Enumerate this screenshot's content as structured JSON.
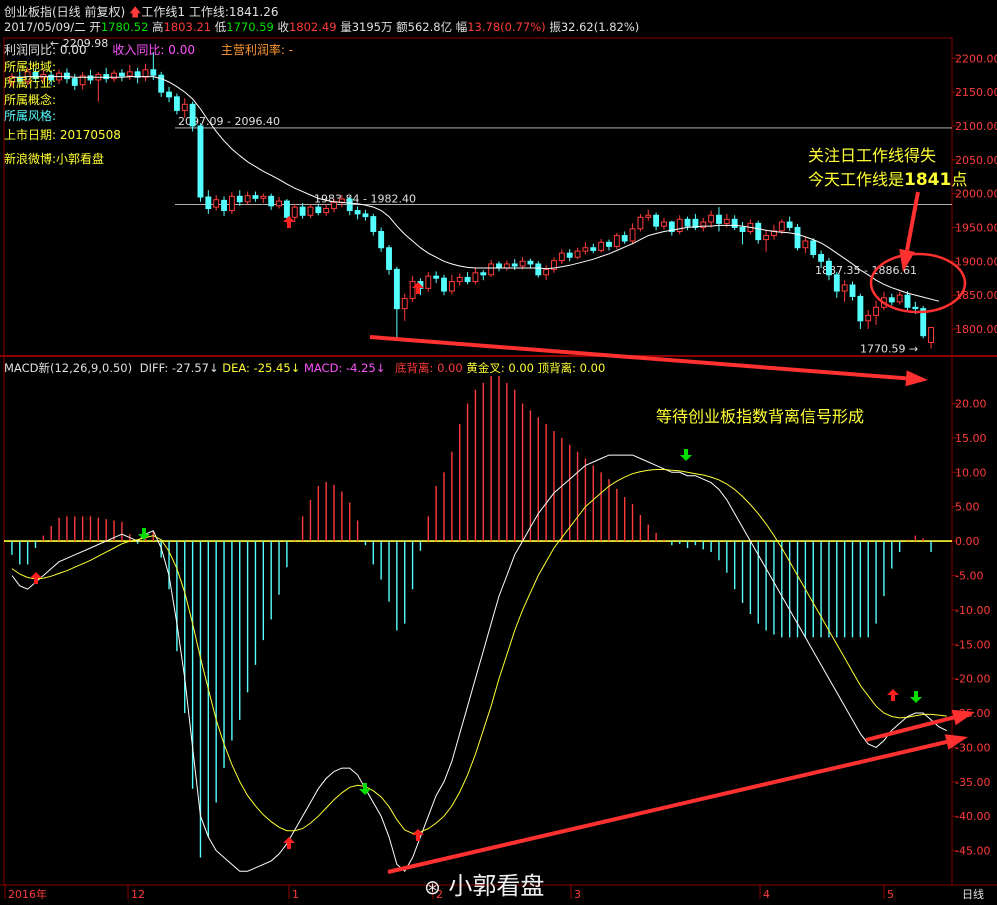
{
  "header": {
    "title": "创业板指(日线 前复权)",
    "workline1_label": "工作线1",
    "workline_label": "工作线:",
    "workline_value": "1841.26",
    "date": "2017/05/09/二",
    "open_label": "开",
    "open": "1780.52",
    "high_label": "高",
    "high": "1803.21",
    "low_label": "低",
    "low": "1770.59",
    "close_label": "收",
    "close": "1802.49",
    "volume_label": "量",
    "volume": "3195万",
    "amount_label": "额",
    "amount": "562.8亿",
    "change_label": "幅",
    "change": "13.78(0.77%)",
    "amplitude_label": "振",
    "amplitude": "32.62(1.82%)"
  },
  "info_panel": {
    "profit_yoy": "利润同比: 0.00",
    "revenue_yoy": "收入同比: 0.00",
    "margin": "主营利润率: -",
    "region": "所属地域:",
    "industry": "所属行业:",
    "concept": "所属概念:",
    "style": "所属风格:",
    "listing": "上市日期: 20170508",
    "weibo": "新浪微博:小郭看盘"
  },
  "annotations": {
    "note1_line1": "关注日工作线得失",
    "note1_line2_prefix": "今天工作线是",
    "note1_line2_value": "1841",
    "note1_line2_suffix": "点",
    "note2": "等待创业板指数背离信号形成",
    "price_label_top": "2209.98",
    "price_label_low": "1770.59",
    "level1": "2097.09 - 2096.40",
    "level2": "1983.84 - 1982.40",
    "level3": "1887.35 - 1886.61"
  },
  "macd_header": {
    "name": "MACD新(12,26,9,0.50)",
    "diff_label": "DIFF:",
    "diff": "-27.57",
    "dea_label": "DEA:",
    "dea": "-25.45",
    "macd_label": "MACD:",
    "macd": "-4.25",
    "bottom_div": "底背离: 0.00",
    "golden": "黄金叉: 0.00",
    "top_div": "顶背离: 0.00"
  },
  "x_axis": {
    "labels": [
      "2016年",
      "12",
      "1",
      "2",
      "3",
      "4",
      "5"
    ],
    "period": "日线"
  },
  "watermark": "小郭看盘",
  "colors": {
    "up": "#ff3b3b",
    "down": "#55ffff",
    "ma": "#ffffff",
    "dea": "#ffff33",
    "grid": "#8b0000",
    "annot": "#ff3030"
  },
  "chart_data": [
    {
      "type": "candlestick",
      "name": "price",
      "ylim": [
        1760,
        2230
      ],
      "y_ticks": [
        1800,
        1850,
        1900,
        1950,
        2000,
        2050,
        2100,
        2150,
        2200
      ],
      "y_tick_labels": [
        "1800.00",
        "1850.00",
        "1900.00",
        "1950.00",
        "2000.00",
        "2050.00",
        "2100.00",
        "2150.00",
        "2200.00"
      ],
      "horizontal_levels": [
        2097.09,
        1983.84
      ],
      "candles": [
        [
          2165,
          2173,
          2178,
          2158
        ],
        [
          2172,
          2166,
          2180,
          2160
        ],
        [
          2166,
          2180,
          2186,
          2161
        ],
        [
          2179,
          2170,
          2185,
          2164
        ],
        [
          2171,
          2176,
          2183,
          2165
        ],
        [
          2175,
          2168,
          2181,
          2160
        ],
        [
          2168,
          2178,
          2183,
          2162
        ],
        [
          2178,
          2170,
          2185,
          2163
        ],
        [
          2170,
          2160,
          2177,
          2153
        ],
        [
          2161,
          2174,
          2180,
          2154
        ],
        [
          2174,
          2168,
          2183,
          2162
        ],
        [
          2168,
          2176,
          2180,
          2136
        ],
        [
          2176,
          2170,
          2186,
          2164
        ],
        [
          2170,
          2178,
          2183,
          2165
        ],
        [
          2178,
          2174,
          2184,
          2166
        ],
        [
          2174,
          2180,
          2190,
          2168
        ],
        [
          2180,
          2172,
          2186,
          2163
        ],
        [
          2172,
          2183,
          2192,
          2166
        ],
        [
          2183,
          2175,
          2209,
          2168
        ],
        [
          2175,
          2150,
          2180,
          2143
        ],
        [
          2150,
          2143,
          2158,
          2135
        ],
        [
          2143,
          2123,
          2148,
          2117
        ],
        [
          2123,
          2132,
          2141,
          2112
        ],
        [
          2132,
          2100,
          2136,
          2092
        ],
        [
          2100,
          1995,
          2104,
          1988
        ],
        [
          1995,
          1978,
          2005,
          1970
        ],
        [
          1980,
          1991,
          1998,
          1975
        ],
        [
          1990,
          1975,
          1996,
          1967
        ],
        [
          1975,
          1996,
          2002,
          1970
        ],
        [
          1996,
          1988,
          2005,
          1982
        ],
        [
          1988,
          1997,
          2003,
          1984
        ],
        [
          1997,
          1993,
          2003,
          1988
        ],
        [
          1993,
          1996,
          2000,
          1986
        ],
        [
          1996,
          1982,
          2000,
          1976
        ],
        [
          1982,
          1989,
          1995,
          1978
        ],
        [
          1989,
          1965,
          1992,
          1960
        ],
        [
          1965,
          1980,
          1985,
          1958
        ],
        [
          1980,
          1968,
          1986,
          1963
        ],
        [
          1968,
          1980,
          1984,
          1964
        ],
        [
          1980,
          1972,
          1985,
          1968
        ],
        [
          1972,
          1978,
          1984,
          1967
        ],
        [
          1978,
          1987,
          1992,
          1972
        ],
        [
          1987,
          1992,
          1998,
          1980
        ],
        [
          1992,
          1975,
          1996,
          1968
        ],
        [
          1975,
          1970,
          1981,
          1962
        ],
        [
          1970,
          1966,
          1976,
          1960
        ],
        [
          1966,
          1944,
          1970,
          1938
        ],
        [
          1944,
          1920,
          1950,
          1914
        ],
        [
          1920,
          1888,
          1924,
          1880
        ],
        [
          1888,
          1830,
          1892,
          1786
        ],
        [
          1830,
          1845,
          1852,
          1812
        ],
        [
          1845,
          1870,
          1878,
          1840
        ],
        [
          1870,
          1860,
          1875,
          1850
        ],
        [
          1860,
          1878,
          1884,
          1855
        ],
        [
          1878,
          1875,
          1885,
          1868
        ],
        [
          1875,
          1856,
          1880,
          1850
        ],
        [
          1856,
          1870,
          1880,
          1851
        ],
        [
          1870,
          1876,
          1882,
          1864
        ],
        [
          1876,
          1870,
          1884,
          1866
        ],
        [
          1870,
          1883,
          1890,
          1866
        ],
        [
          1883,
          1880,
          1887,
          1872
        ],
        [
          1880,
          1896,
          1902,
          1877
        ],
        [
          1896,
          1890,
          1900,
          1885
        ],
        [
          1890,
          1896,
          1901,
          1886
        ],
        [
          1896,
          1893,
          1903,
          1887
        ],
        [
          1893,
          1900,
          1906,
          1888
        ],
        [
          1900,
          1896,
          1904,
          1890
        ],
        [
          1896,
          1880,
          1900,
          1876
        ],
        [
          1880,
          1888,
          1894,
          1872
        ],
        [
          1888,
          1901,
          1906,
          1883
        ],
        [
          1901,
          1912,
          1918,
          1896
        ],
        [
          1912,
          1906,
          1918,
          1900
        ],
        [
          1906,
          1915,
          1920,
          1903
        ],
        [
          1915,
          1920,
          1928,
          1910
        ],
        [
          1920,
          1916,
          1926,
          1912
        ],
        [
          1916,
          1928,
          1933,
          1913
        ],
        [
          1928,
          1922,
          1932,
          1916
        ],
        [
          1922,
          1938,
          1942,
          1918
        ],
        [
          1938,
          1930,
          1944,
          1926
        ],
        [
          1930,
          1948,
          1956,
          1925
        ],
        [
          1948,
          1965,
          1970,
          1944
        ],
        [
          1965,
          1968,
          1976,
          1960
        ],
        [
          1968,
          1952,
          1972,
          1946
        ],
        [
          1952,
          1958,
          1964,
          1947
        ],
        [
          1958,
          1944,
          1960,
          1938
        ],
        [
          1944,
          1962,
          1968,
          1940
        ],
        [
          1962,
          1952,
          1966,
          1946
        ],
        [
          1962,
          1950,
          1970,
          1946
        ],
        [
          1950,
          1958,
          1964,
          1944
        ],
        [
          1958,
          1968,
          1975,
          1950
        ],
        [
          1968,
          1956,
          1980,
          1944
        ],
        [
          1956,
          1962,
          1970,
          1950
        ],
        [
          1962,
          1950,
          1968,
          1946
        ],
        [
          1950,
          1944,
          1958,
          1925
        ],
        [
          1944,
          1956,
          1962,
          1940
        ],
        [
          1956,
          1932,
          1960,
          1926
        ],
        [
          1932,
          1938,
          1946,
          1914
        ],
        [
          1938,
          1945,
          1954,
          1932
        ],
        [
          1945,
          1958,
          1962,
          1940
        ],
        [
          1958,
          1950,
          1966,
          1945
        ],
        [
          1950,
          1920,
          1955,
          1916
        ],
        [
          1920,
          1930,
          1936,
          1912
        ],
        [
          1930,
          1910,
          1934,
          1905
        ],
        [
          1910,
          1900,
          1916,
          1890
        ],
        [
          1900,
          1880,
          1905,
          1872
        ],
        [
          1880,
          1856,
          1884,
          1846
        ],
        [
          1856,
          1865,
          1872,
          1840
        ],
        [
          1865,
          1848,
          1870,
          1842
        ],
        [
          1848,
          1812,
          1852,
          1800
        ],
        [
          1812,
          1820,
          1828,
          1800
        ],
        [
          1820,
          1832,
          1842,
          1806
        ],
        [
          1832,
          1846,
          1855,
          1828
        ],
        [
          1846,
          1840,
          1852,
          1835
        ],
        [
          1840,
          1850,
          1855,
          1836
        ],
        [
          1850,
          1832,
          1856,
          1826
        ],
        [
          1832,
          1830,
          1840,
          1822
        ],
        [
          1830,
          1790,
          1834,
          1786
        ],
        [
          1780,
          1802,
          1803,
          1771
        ]
      ],
      "ma": [
        2172,
        2172,
        2173,
        2173,
        2173,
        2173,
        2173,
        2173,
        2172,
        2172,
        2172,
        2172,
        2172,
        2172,
        2172,
        2173,
        2173,
        2173,
        2173,
        2170,
        2165,
        2158,
        2150,
        2140,
        2125,
        2108,
        2092,
        2078,
        2066,
        2056,
        2047,
        2040,
        2033,
        2027,
        2021,
        2014,
        2008,
        2003,
        1998,
        1993,
        1990,
        1988,
        1987,
        1986,
        1985,
        1983,
        1980,
        1975,
        1966,
        1952,
        1940,
        1930,
        1920,
        1912,
        1906,
        1900,
        1896,
        1893,
        1891,
        1890,
        1890,
        1890,
        1890,
        1890,
        1890,
        1890,
        1890,
        1890,
        1889,
        1890,
        1892,
        1894,
        1897,
        1900,
        1903,
        1907,
        1911,
        1916,
        1921,
        1926,
        1932,
        1938,
        1941,
        1944,
        1946,
        1948,
        1950,
        1951,
        1952,
        1952,
        1953,
        1953,
        1953,
        1952,
        1950,
        1948,
        1946,
        1944,
        1943,
        1942,
        1940,
        1936,
        1932,
        1927,
        1920,
        1912,
        1904,
        1896,
        1887,
        1880,
        1872,
        1866,
        1861,
        1857,
        1853,
        1850,
        1847,
        1844,
        1841
      ]
    },
    {
      "type": "macd",
      "name": "MACD新(12,26,9,0.50)",
      "ylim": [
        -50,
        24
      ],
      "y_ticks": [
        20,
        15,
        10,
        5,
        0,
        -5,
        -10,
        -15,
        -20,
        -25,
        -30,
        -35,
        -40,
        -45
      ],
      "y_tick_labels": [
        "20.00",
        "15.00",
        "10.00",
        "5.00",
        "0.00",
        "-5.00",
        "-10.00",
        "-15.00",
        "-20.00",
        "-25.00",
        "-30.00",
        "-35.00",
        "-40.00",
        "-45.00"
      ],
      "diff": [
        -5,
        -6.5,
        -7,
        -6,
        -5,
        -4,
        -3,
        -2.5,
        -2,
        -1.5,
        -1,
        -0.5,
        0,
        0.5,
        1,
        0.5,
        0,
        1,
        1.5,
        -1,
        -5,
        -12,
        -20,
        -30,
        -40,
        -43,
        -45,
        -46,
        -47,
        -48,
        -48,
        -47.5,
        -47,
        -46.5,
        -45.5,
        -44,
        -42,
        -40,
        -38,
        -36,
        -34.5,
        -33.5,
        -33,
        -33,
        -34,
        -36,
        -38,
        -40,
        -43,
        -47,
        -48,
        -46,
        -43,
        -40,
        -37,
        -35,
        -32,
        -28,
        -24,
        -20,
        -16,
        -12,
        -8,
        -5,
        -2,
        0,
        2,
        4,
        5.5,
        7,
        8,
        9,
        10,
        11,
        11.5,
        12,
        12.5,
        12.5,
        12.5,
        12.5,
        12,
        11.5,
        11,
        10.5,
        10,
        10,
        9.5,
        9.5,
        9,
        8.5,
        7.5,
        6,
        4,
        2,
        0,
        -2,
        -4,
        -6,
        -8,
        -10,
        -12,
        -14,
        -16,
        -18,
        -20,
        -22,
        -24,
        -26,
        -28,
        -29.5,
        -30,
        -29,
        -27.5,
        -26.5,
        -25.5,
        -25,
        -25,
        -26,
        -27,
        -27.57
      ],
      "dea": [
        -4,
        -4.8,
        -5.3,
        -5.5,
        -5.4,
        -5.1,
        -4.7,
        -4.3,
        -3.8,
        -3.3,
        -2.8,
        -2.2,
        -1.6,
        -1,
        -0.4,
        0,
        0.2,
        0.5,
        0.8,
        0.2,
        -1.5,
        -4,
        -7.5,
        -12,
        -17,
        -21.5,
        -26,
        -29.5,
        -32.5,
        -35,
        -37,
        -38.5,
        -39.8,
        -40.8,
        -41.6,
        -42.1,
        -42.1,
        -41.8,
        -41,
        -40,
        -38.8,
        -37.6,
        -36.6,
        -35.8,
        -35.5,
        -35.7,
        -36.3,
        -37.2,
        -38.6,
        -40.5,
        -42,
        -42.5,
        -42.3,
        -41.8,
        -41,
        -40,
        -38.5,
        -36.5,
        -34,
        -31,
        -27.5,
        -24,
        -20,
        -16.5,
        -13,
        -10,
        -7.5,
        -5,
        -3,
        -1,
        0.5,
        2,
        3.5,
        5,
        6,
        7,
        8,
        8.7,
        9.3,
        9.8,
        10.1,
        10.3,
        10.4,
        10.4,
        10.3,
        10.2,
        10,
        9.8,
        9.6,
        9.3,
        8.9,
        8.3,
        7.5,
        6.5,
        5.3,
        4,
        2.5,
        0.8,
        -1,
        -3,
        -5,
        -7,
        -9,
        -11,
        -13,
        -15,
        -17,
        -19,
        -21,
        -22.5,
        -24,
        -25,
        -25.5,
        -25.7,
        -25.6,
        -25.4,
        -25.2,
        -25.2,
        -25.3,
        -25.45
      ]
    }
  ]
}
